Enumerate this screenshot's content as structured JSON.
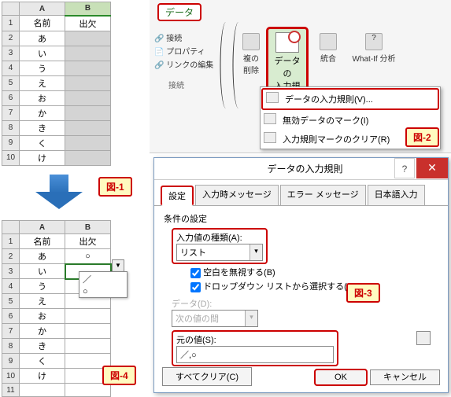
{
  "sheet1": {
    "headers": [
      "",
      "A",
      "B"
    ],
    "row_labels": [
      "1",
      "2",
      "3",
      "4",
      "5",
      "6",
      "7",
      "8",
      "9",
      "10"
    ],
    "colA": [
      "名前",
      "あ",
      "い",
      "う",
      "え",
      "お",
      "か",
      "き",
      "く",
      "け"
    ],
    "colB_header": "出欠"
  },
  "sheet2": {
    "headers": [
      "",
      "A",
      "B"
    ],
    "row_labels": [
      "1",
      "2",
      "3",
      "4",
      "5",
      "6",
      "7",
      "8",
      "9",
      "10",
      "11"
    ],
    "colA": [
      "名前",
      "あ",
      "い",
      "う",
      "え",
      "お",
      "か",
      "き",
      "く",
      "け",
      ""
    ],
    "colB": [
      "出欠",
      "○",
      "",
      "",
      "",
      "",
      "",
      "",
      "",
      "",
      ""
    ]
  },
  "dropdown_options": [
    "／",
    "○"
  ],
  "ribbon": {
    "tab": "データ",
    "group1_label": "接続",
    "btn_connect": "接続",
    "btn_property": "プロパティ",
    "btn_editlink": "リンクの編集",
    "btn_dup": "複の",
    "btn_dup2": "削除",
    "btn_dv": "データの",
    "btn_dv2": "入力規則",
    "btn_consol": "統合",
    "btn_whatif": "What-If 分析"
  },
  "dd_menu": {
    "item1": "データの入力規則(V)...",
    "item2": "無効データのマーク(I)",
    "item3": "入力規則マークのクリア(R)"
  },
  "dialog": {
    "title": "データの入力規則",
    "tabs": [
      "設定",
      "入力時メッセージ",
      "エラー メッセージ",
      "日本語入力"
    ],
    "group": "条件の設定",
    "type_label": "入力値の種類(A):",
    "type_value": "リスト",
    "chk_blank": "空白を無視する(B)",
    "chk_dd": "ドロップダウン リストから選択する(I)",
    "data_label": "データ(D):",
    "data_value": "次の値の間",
    "src_label": "元の値(S):",
    "src_value": "／,○",
    "clear": "すべてクリア(C)",
    "ok": "OK",
    "cancel": "キャンセル"
  },
  "figs": {
    "f1": "図-1",
    "f2": "図-2",
    "f3": "図-3",
    "f4": "図-4"
  }
}
